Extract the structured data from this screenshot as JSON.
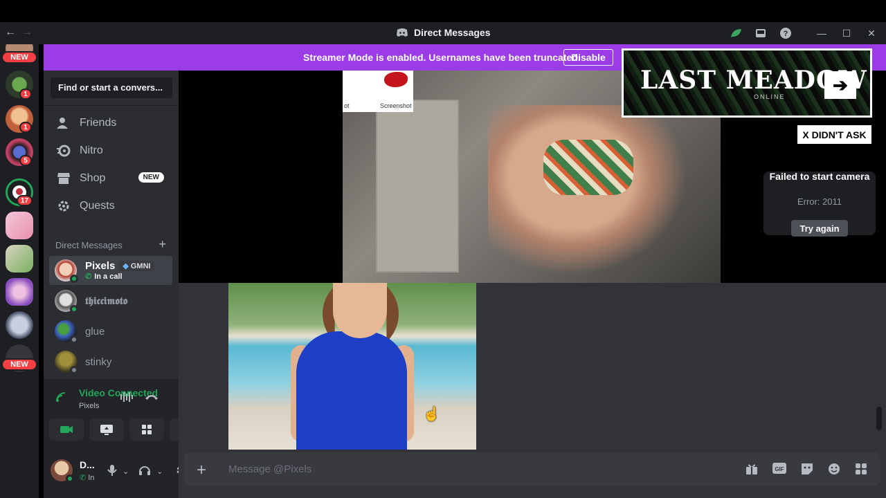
{
  "titlebar": {
    "back_icon": "arrow-left-icon",
    "forward_icon": "arrow-right-icon",
    "title": "Direct Messages",
    "icons": [
      "nitro-leaf-icon",
      "inbox-icon",
      "help-icon",
      "minimize-icon",
      "maximize-icon",
      "close-icon"
    ]
  },
  "guilds": {
    "new_label": "NEW",
    "badges": [
      "1",
      "1",
      "5",
      "17"
    ],
    "new_label_bottom": "NEW"
  },
  "banner": {
    "text": "Streamer Mode is enabled. Usernames have been truncated.",
    "button": "Disable"
  },
  "sidebar": {
    "search_placeholder": "Find or start a convers...",
    "nav": [
      {
        "label": "Friends",
        "icon": "friends-icon"
      },
      {
        "label": "Nitro",
        "icon": "nitro-icon"
      },
      {
        "label": "Shop",
        "icon": "shop-icon",
        "badge": "NEW"
      },
      {
        "label": "Quests",
        "icon": "quests-icon"
      }
    ],
    "dm_header": "Direct Messages",
    "dm_add": "+",
    "dms": [
      {
        "name": "Pixels",
        "tag": "GMNI",
        "status": "In a call",
        "active": true,
        "presence": "#23a55a"
      },
      {
        "name": "𝖙𝖍𝖎𝖈𝖈𝖎𝖒𝖔𝖙𝖔",
        "presence": "#23a55a"
      },
      {
        "name": "glue",
        "presence": "#80848e"
      },
      {
        "name": "stinky",
        "presence": "#80848e"
      }
    ]
  },
  "voice": {
    "status": "Video Connected",
    "channel": "Pixels"
  },
  "user": {
    "name": "D...",
    "status": "In"
  },
  "stage": {
    "thumb_label": "Screenshot",
    "thumb_label_left": "ot",
    "failed_title": "Failed to start camera",
    "failed_error": "Error: 2011",
    "try_again": "Try again"
  },
  "ad": {
    "brand": "LAST MEADOW",
    "sub": "ONLINE",
    "close_label": "X DIDN'T ASK"
  },
  "compose": {
    "placeholder": "Message @Pixels",
    "icons": [
      "gift-icon",
      "gif-icon",
      "sticker-icon",
      "emoji-icon",
      "apps-icon"
    ]
  },
  "colors": {
    "banner": "#9b3ce6",
    "online": "#23a55a",
    "danger": "#f23f43"
  }
}
